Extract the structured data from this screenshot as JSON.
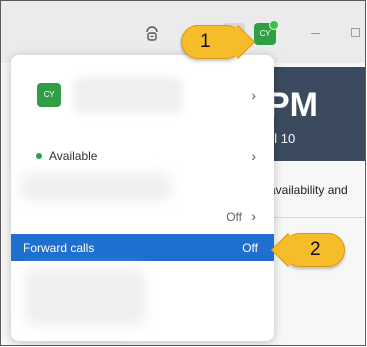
{
  "titlebar": {
    "avatar_initials": "CY",
    "gateway_icon": "headset-gateway-icon",
    "minimize_icon": "minimize-icon",
    "maximize_icon": "maximize-icon"
  },
  "background": {
    "time": "PM",
    "date": "ril 10",
    "line": "availability and"
  },
  "menu": {
    "profile": {
      "initials": "CY",
      "chevron": "›"
    },
    "status": {
      "label": "Available",
      "chevron": "›"
    },
    "off_row": {
      "value": "Off",
      "chevron": "›"
    },
    "forward": {
      "label": "Forward calls",
      "value": "Off"
    }
  },
  "callouts": {
    "one": "1",
    "two": "2"
  },
  "colors": {
    "accent_blue": "#1f6fd1",
    "avatar_green": "#2f9e44",
    "callout_yellow": "#f6bc2a"
  }
}
